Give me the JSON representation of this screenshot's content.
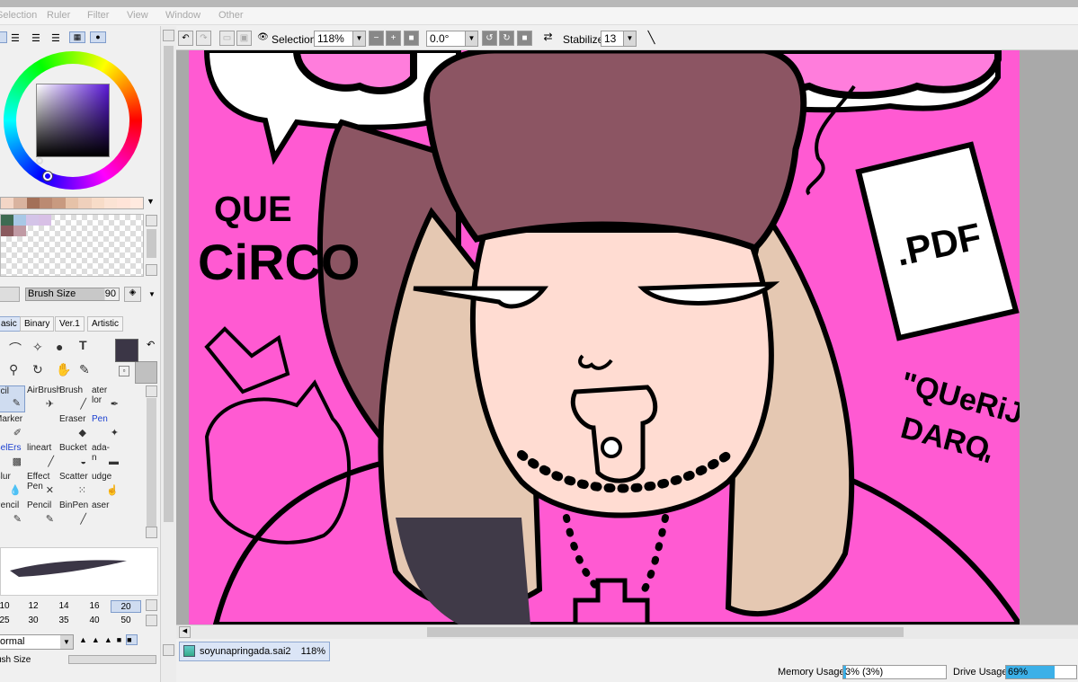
{
  "menu": [
    "Selection",
    "Ruler",
    "Filter",
    "View",
    "Window",
    "Other"
  ],
  "toolbar": {
    "selection_label": "Selection",
    "zoom_value": "118%",
    "angle_value": "0.0°",
    "stabilizer_label": "Stabilizer",
    "stabilizer_value": "13"
  },
  "left": {
    "brush_size_label": "Brush Size",
    "brush_size_value": "90",
    "tool_tabs": [
      "asic",
      "Binary",
      "Ver.1",
      "Artistic"
    ],
    "tools": [
      {
        "label": "ncil",
        "icon": "pencil-icon"
      },
      {
        "label": "AirBrush",
        "icon": "airbrush-icon"
      },
      {
        "label": "Brush",
        "icon": "brush-icon"
      },
      {
        "label": "ater\nlor",
        "icon": "water-color-icon"
      },
      {
        "label": "Marker",
        "icon": "marker-icon"
      },
      {
        "label": "",
        "icon": ""
      },
      {
        "label": "Eraser",
        "icon": "eraser-icon"
      },
      {
        "label": "Pen",
        "icon": "pen-icon"
      },
      {
        "label": "SelErs",
        "icon": "select-eraser-icon"
      },
      {
        "label": "lineart",
        "icon": "lineart-icon"
      },
      {
        "label": "Bucket",
        "icon": "bucket-icon"
      },
      {
        "label": "ada-\nn",
        "icon": "gradation-icon"
      },
      {
        "label": "Blur",
        "icon": "blur-icon"
      },
      {
        "label": "Effect\nPen",
        "icon": "effect-pen-icon"
      },
      {
        "label": "Scatter",
        "icon": "scatter-icon"
      },
      {
        "label": "udge",
        "icon": "smudge-icon"
      },
      {
        "label": "Pencil",
        "icon": "pencil-icon"
      },
      {
        "label": "Pencil",
        "icon": "pencil-icon"
      },
      {
        "label": "BinPen",
        "icon": "binpen-icon"
      },
      {
        "label": "aser",
        "icon": ""
      }
    ],
    "brush_sizes_row1": [
      "10",
      "12",
      "14",
      "16",
      "20"
    ],
    "brush_sizes_row2": [
      "25",
      "30",
      "35",
      "40",
      "50"
    ],
    "blend_mode": "ormal",
    "brush_size_bottom": "ush Size"
  },
  "document": {
    "filename": "soyunapringada.sai2",
    "zoom": "118%"
  },
  "status": {
    "memory_label": "Memory Usage",
    "memory_value": "3% (3%)",
    "memory_fraction": 0.03,
    "drive_label": "Drive Usage",
    "drive_value": "69%",
    "drive_fraction": 0.69
  },
  "artwork": {
    "text_que": "QUE",
    "text_circo": "CiRCO",
    "text_pdf": ".PDF",
    "text_quote_1": "\"QUeRiJO",
    "text_quote_2": "DARO",
    "text_quote_3": "\"",
    "background_color": "#ff5ad2",
    "hat_color": "#8c5563",
    "skin_color": "#ffdcd2",
    "hair_color": "#e5c8b2"
  },
  "colors": {
    "main_color": "#3b3646",
    "sub_color": "#c0c0c0"
  }
}
